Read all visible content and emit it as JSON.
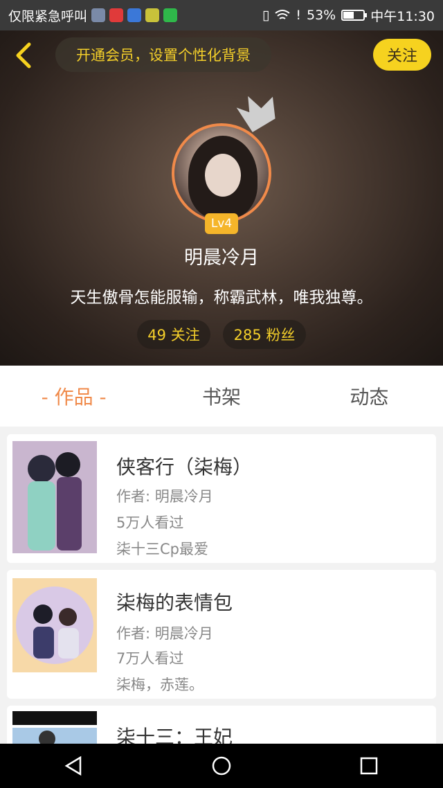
{
  "status_bar": {
    "carrier_text": "仅限紧急呼叫",
    "battery_percent": "53%",
    "battery_level": 0.53,
    "time": "中午11:30"
  },
  "header": {
    "vip_prompt": "开通会员，设置个性化背景",
    "follow_label": "关注",
    "level": "Lv4",
    "nickname": "明晨冷月",
    "bio": "天生傲骨怎能服输，称霸武林，唯我独尊。",
    "following": "49 关注",
    "followers": "285 粉丝"
  },
  "tabs": [
    {
      "label": "- 作品 -",
      "active": true
    },
    {
      "label": "书架",
      "active": false
    },
    {
      "label": "动态",
      "active": false
    }
  ],
  "works": [
    {
      "title": "侠客行（柒梅）",
      "author": "作者: 明晨冷月",
      "views": "5万人看过",
      "desc": "柒十三Cp最爱"
    },
    {
      "title": "柒梅的表情包",
      "author": "作者: 明晨冷月",
      "views": "7万人看过",
      "desc": "柒梅，赤莲。"
    },
    {
      "title": "柒十三：王妃"
    }
  ],
  "colors": {
    "accent": "#f08a4a",
    "gold": "#f4cf2a",
    "follow_bg": "#f6d21f"
  }
}
